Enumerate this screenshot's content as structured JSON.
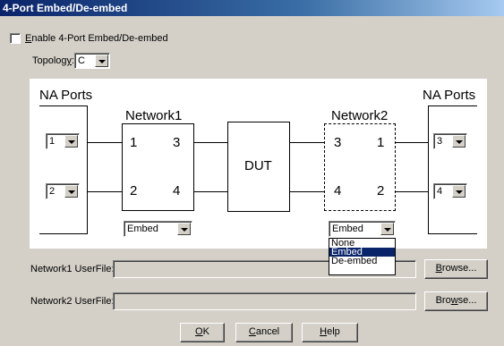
{
  "window": {
    "title": "4-Port Embed/De-embed"
  },
  "enable_checkbox": {
    "label_prefix": "",
    "label_ul": "E",
    "label_rest": "nable 4-Port Embed/De-embed",
    "checked": false
  },
  "topology": {
    "label_prefix": "Topolog",
    "label_ul": "y",
    "label_rest": ":",
    "value": "C"
  },
  "diagram": {
    "na_ports_left": "NA Ports",
    "na_ports_right": "NA Ports",
    "network1": {
      "title": "Network1",
      "port_tl": "1",
      "port_tr": "3",
      "port_bl": "2",
      "port_br": "4",
      "mode": "Embed"
    },
    "network2": {
      "title": "Network2",
      "port_tl": "3",
      "port_tr": "1",
      "port_bl": "4",
      "port_br": "2",
      "mode": "Embed"
    },
    "dut_label": "DUT",
    "left_port_top": "1",
    "left_port_bottom": "2",
    "right_port_top": "3",
    "right_port_bottom": "4"
  },
  "network2_dropdown": {
    "options": [
      "None",
      "Embed",
      "De-embed"
    ],
    "selected": "Embed"
  },
  "network1_userfile": {
    "label": "Network1 UserFile:",
    "value": "",
    "browse": {
      "prefix": "",
      "ul": "B",
      "rest": "rowse..."
    }
  },
  "network2_userfile": {
    "label": "Network2 UserFile:",
    "value": "",
    "browse": {
      "prefix": "Bro",
      "ul": "w",
      "rest": "se..."
    }
  },
  "buttons": {
    "ok": {
      "prefix": "",
      "ul": "O",
      "rest": "K"
    },
    "cancel": {
      "prefix": "",
      "ul": "C",
      "rest": "ancel"
    },
    "help": {
      "prefix": "",
      "ul": "H",
      "rest": "elp"
    }
  }
}
